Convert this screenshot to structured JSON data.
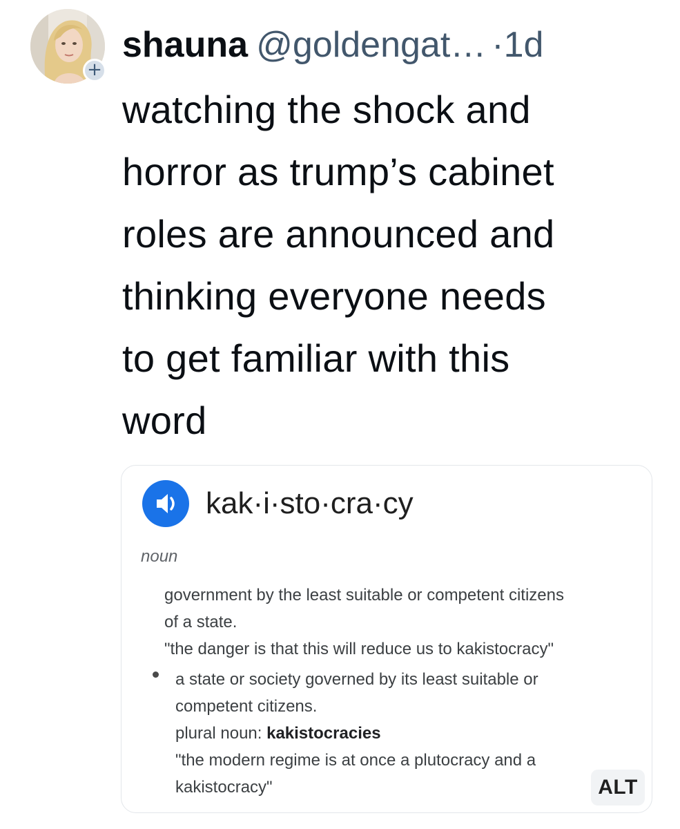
{
  "post": {
    "author_name": "shauna",
    "handle": "@goldengat…",
    "separator": "·",
    "time": "1d",
    "follow_badge": "+",
    "avatar_icon": "user-avatar-photo",
    "text_lines": [
      "watching the shock and",
      "horror as trump’s cabinet",
      "roles are announced and",
      "thinking everyone needs",
      "to get familiar with this",
      "word"
    ]
  },
  "image_card": {
    "speaker_icon": "speaker-icon",
    "headword": "kak·i·sto·cra·cy",
    "part_of_speech": "noun",
    "definition_1": {
      "lines": [
        "government by the least suitable or competent citizens",
        "of a state.",
        "\"the danger is that this will reduce us to kakistocracy\""
      ]
    },
    "definition_2": {
      "lines": [
        "a state or society governed by its least suitable or",
        "competent citizens."
      ],
      "plural_label": "plural noun: ",
      "plural_word": "kakistocracies",
      "example_lines": [
        "\"the modern regime is at once a plutocracy and a",
        "kakistocracy\""
      ]
    },
    "alt_badge": "ALT"
  },
  "colors": {
    "text_primary": "#0b0f14",
    "text_secondary": "#42576c",
    "speaker_blue": "#1a73e8",
    "card_border": "#e3e6ea"
  }
}
